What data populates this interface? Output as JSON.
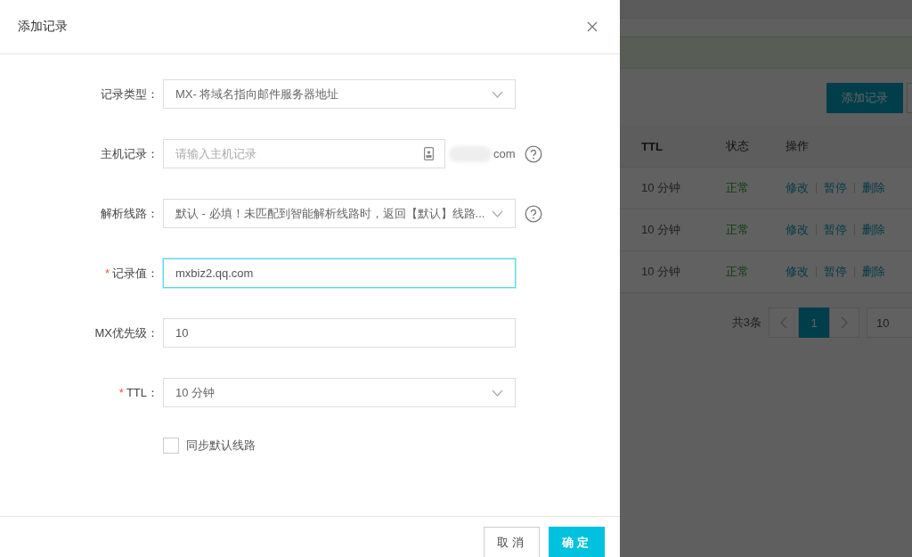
{
  "background_page": {
    "add_button": "添加记录",
    "table": {
      "columns": [
        "TTL",
        "状态",
        "操作"
      ],
      "rows": [
        {
          "ttl": "10 分钟",
          "status": "正常",
          "actions": [
            "修改",
            "暂停",
            "删除"
          ]
        },
        {
          "ttl": "10 分钟",
          "status": "正常",
          "actions": [
            "修改",
            "暂停",
            "删除"
          ]
        },
        {
          "ttl": "10 分钟",
          "status": "正常",
          "actions": [
            "修改",
            "暂停",
            "删除"
          ]
        }
      ]
    },
    "pagination": {
      "total": "共3条",
      "pages": [
        {
          "label": "1",
          "selected": true
        }
      ],
      "page_size": "10"
    }
  },
  "dialog": {
    "title": "添加记录",
    "fields": [
      {
        "kind": "select",
        "label": "记录类型：",
        "focused": false,
        "help": false,
        "value": "MX- 将域名指向邮件服务器地址"
      },
      {
        "kind": "input",
        "label": "主机记录：",
        "focused": false,
        "help": true,
        "placeholder": "请输入主机记录",
        "suffix": "com"
      },
      {
        "kind": "select",
        "label": "解析线路：",
        "focused": false,
        "help": true,
        "value": "默认 - 必填！未匹配到智能解析线路时，返回【默认】线路..."
      },
      {
        "kind": "input",
        "label": "记录值：",
        "required_mark": "*",
        "focused": true,
        "help": false,
        "value": "mxbiz2.qq.com"
      },
      {
        "kind": "input",
        "label": "MX优先级：",
        "focused": false,
        "help": false,
        "value": "10"
      },
      {
        "kind": "select",
        "label": "TTL：",
        "required_mark": "*",
        "focused": false,
        "help": false,
        "value": "10 分钟"
      }
    ],
    "checkbox": {
      "label": "同步默认线路",
      "checked": false
    },
    "buttons": [
      {
        "label": "取消",
        "kind": "secondary"
      },
      {
        "label": "确定",
        "kind": "primary"
      }
    ]
  }
}
